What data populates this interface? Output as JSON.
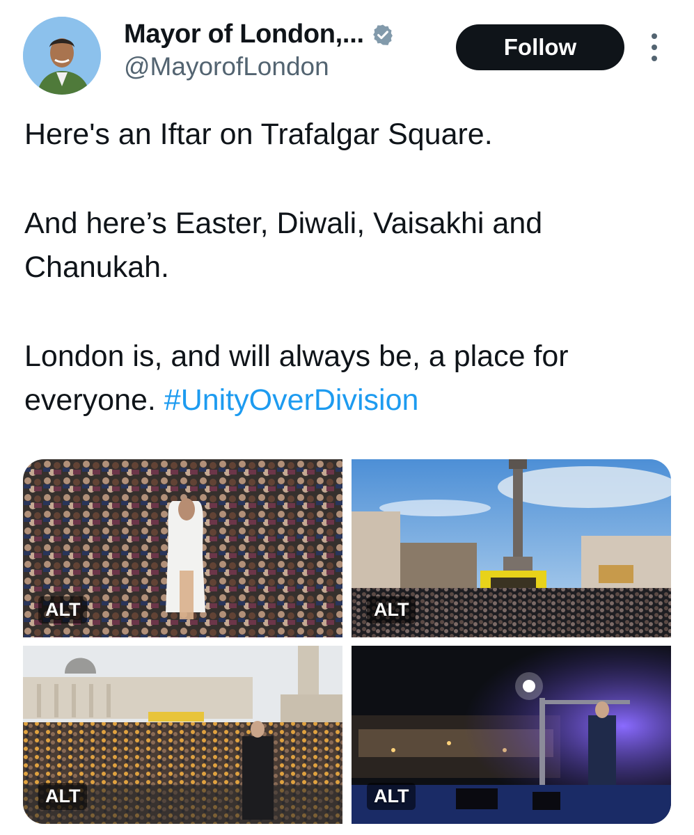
{
  "author": {
    "display_name": "Mayor of London,...",
    "handle": "@MayorofLondon",
    "verified_icon": "verified-badge-icon",
    "avatar_icon": "profile-photo"
  },
  "actions": {
    "follow_label": "Follow",
    "more_icon": "more-vertical-icon"
  },
  "tweet": {
    "paragraph1": "Here's an Iftar on Trafalgar Square.",
    "paragraph2": "And here’s Easter, Diwali, Vaisakhi and Chanukah.",
    "paragraph3_text": "London is, and will always be, a place for everyone. ",
    "hashtag": "#UnityOverDivision"
  },
  "media": [
    {
      "alt_badge": "ALT"
    },
    {
      "alt_badge": "ALT"
    },
    {
      "alt_badge": "ALT"
    },
    {
      "alt_badge": "ALT"
    }
  ],
  "colors": {
    "text": "#0f1419",
    "secondary": "#536471",
    "link": "#1d9bf0",
    "button_bg": "#0f1419"
  }
}
